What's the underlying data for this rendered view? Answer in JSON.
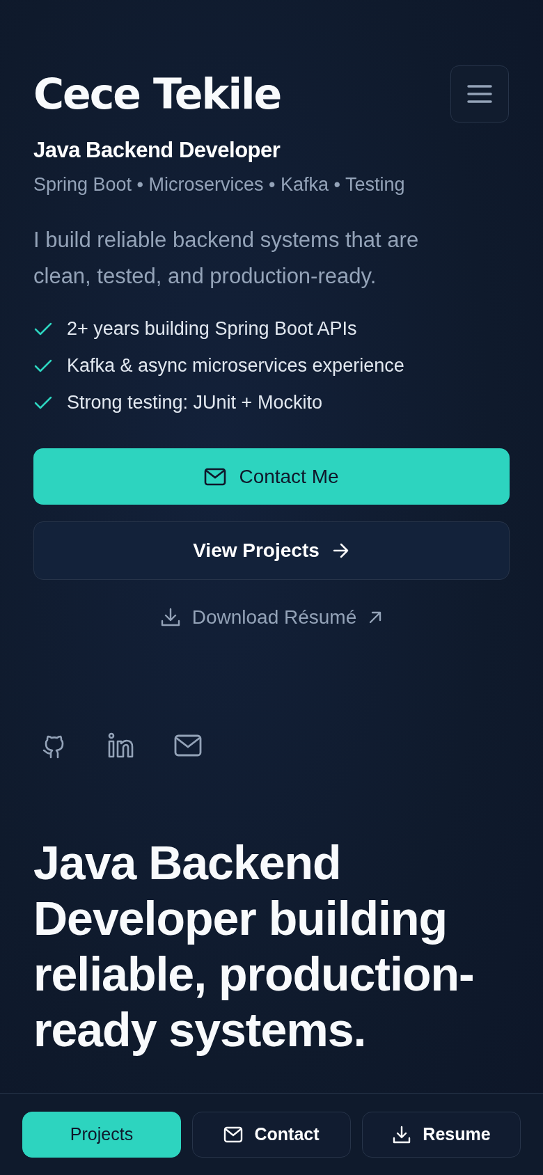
{
  "header": {
    "name": "Cece Tekile"
  },
  "role": "Java Backend Developer",
  "skills": "Spring Boot • Microservices • Kafka • Testing",
  "intro": "I build reliable backend systems that are clean, tested, and production-ready.",
  "highlights": [
    "2+ years building Spring Boot APIs",
    "Kafka & async microservices experience",
    "Strong testing: JUnit + Mockito"
  ],
  "actions": [
    {
      "kind": "primary",
      "label": "Contact Me"
    },
    {
      "kind": "secondary",
      "label": "View Projects"
    },
    {
      "kind": "link",
      "label": "Download Résumé"
    }
  ],
  "social": [
    {
      "kind": "github"
    },
    {
      "kind": "linkedin"
    },
    {
      "kind": "email"
    }
  ],
  "headline": "Java Backend Developer building reliable, production-ready systems.",
  "bottom_nav": [
    {
      "kind": "projects",
      "label": "Projects",
      "selected": true
    },
    {
      "kind": "contact",
      "label": "Contact",
      "selected": false
    },
    {
      "kind": "resume",
      "label": "Resume",
      "selected": false
    }
  ]
}
